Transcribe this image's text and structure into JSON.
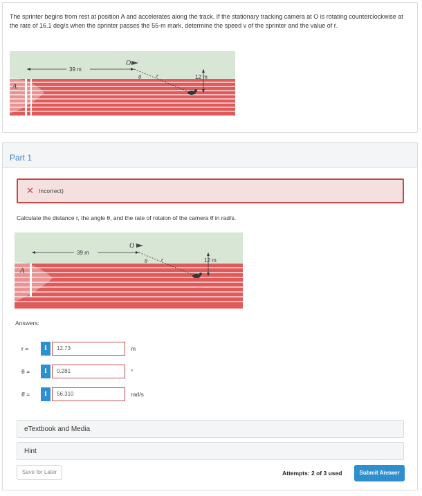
{
  "problem": {
    "text": "The sprinter begins from rest at position A and accelerates along the track. If the stationary tracking camera at O is rotating counterclockwise at the rate of 16.1 deg/s when the sprinter passes the 55-m mark, determine the speed v of the sprinter and the value of ṙ.",
    "diagram": {
      "dist_label": "39 m",
      "height_label": "12 m",
      "o_label": "O",
      "theta_label": "θ",
      "r_label": "r",
      "a_label": "A"
    }
  },
  "part": {
    "title": "Part 1",
    "feedback_icon": "✕",
    "feedback_text": "Incorrect)",
    "instruction": "Calculate the distance r, the angle θ, and the rate of rotaion of the camera θ̇ in rad/s.",
    "diagram": {
      "dist_label": "39 m",
      "height_label": "12 m",
      "o_label": "O",
      "theta_label": "θ",
      "r_label": "r",
      "a_label": "A"
    },
    "answers_label": "Answers:",
    "answers": [
      {
        "label": "r =",
        "value": "12.73",
        "unit": "m"
      },
      {
        "label": "θ =",
        "value": "0.281",
        "unit": "°"
      },
      {
        "label": "θ̇ =",
        "value": "56.310",
        "unit": "rad/s"
      }
    ],
    "info_badge": "i",
    "etextbook_label": "eTextbook and Media",
    "hint_label": "Hint",
    "save_label": "Save for Later",
    "attempts_text": "Attempts: 2 of 3 used",
    "submit_label": "Submit Answer"
  },
  "colors": {
    "accent": "#2e8fce",
    "error": "#c04a4a",
    "error_bg": "#f5e0e0",
    "track": "#e05a5a",
    "grass": "#d8e6d6"
  },
  "icons": [
    "close-icon",
    "info-icon"
  ]
}
